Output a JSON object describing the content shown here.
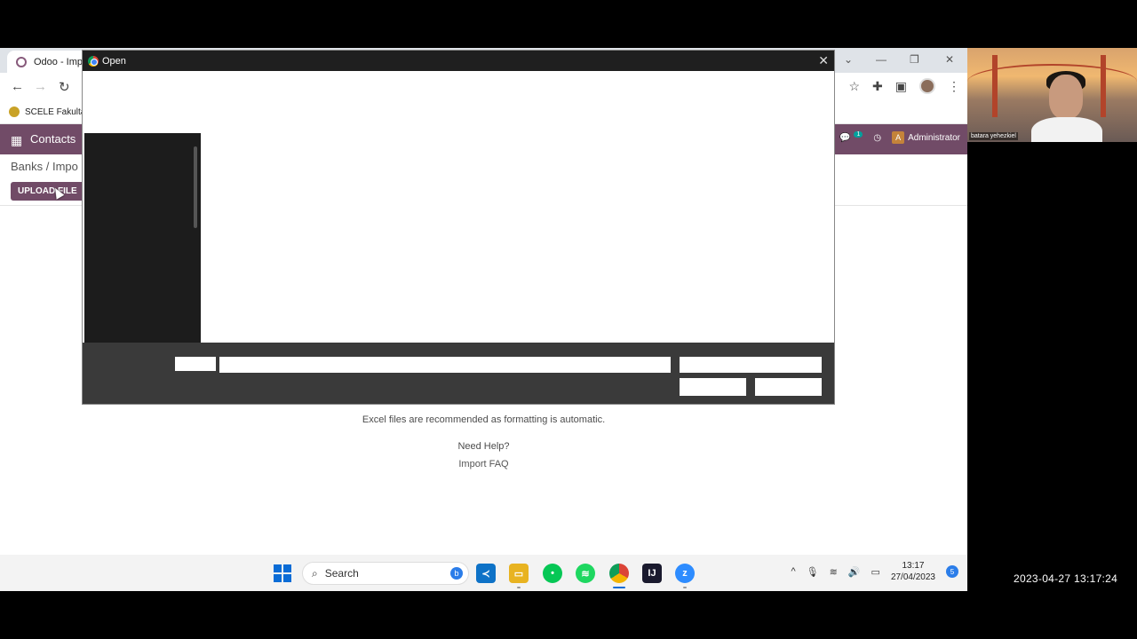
{
  "browser": {
    "tab_title": "Odoo - Impo",
    "bookmark_label": "SCELE Fakulta"
  },
  "odoo": {
    "app_name": "Contacts",
    "breadcrumb": "Banks / Impo",
    "upload_button": "UPLOAD FILE",
    "chat_badge": "1",
    "user_initial": "A",
    "user_name": "Administrator",
    "hint_text": "Excel files are recommended as formatting is automatic.",
    "help_text": "Need Help?",
    "faq_link": "Import FAQ",
    "brand_color": "#714b67"
  },
  "dialog": {
    "title": "Open",
    "close_icon": "close-icon"
  },
  "taskbar": {
    "search_label": "Search",
    "time": "13:17",
    "date": "27/04/2023",
    "notification_count": "5"
  },
  "webcam": {
    "participant_name": "batara yehezkiel"
  },
  "recording_timestamp": "2023-04-27  13:17:24"
}
